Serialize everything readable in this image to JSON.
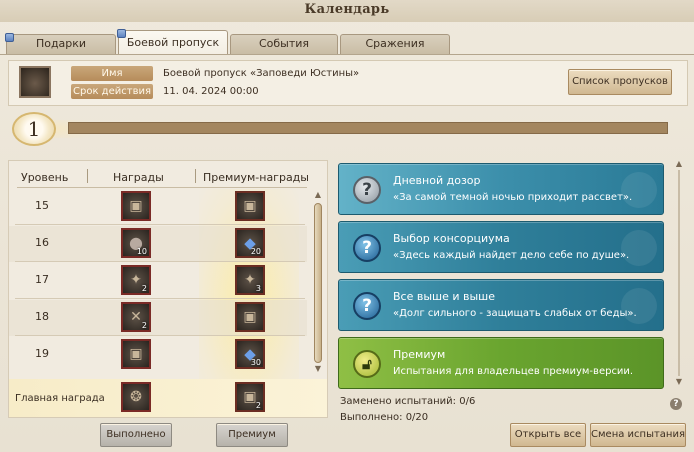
{
  "window": {
    "title": "Календарь"
  },
  "tabs": [
    {
      "label": "Подарки",
      "active": false,
      "marker": true
    },
    {
      "label": "Боевой пропуск",
      "active": true,
      "marker": true
    },
    {
      "label": "События",
      "active": false,
      "marker": false
    },
    {
      "label": "Сражения",
      "active": false,
      "marker": false
    }
  ],
  "pass_info": {
    "name_label": "Имя",
    "name_value": "Боевой пропуск «Заповеди Юстины»",
    "period_label": "Срок действия",
    "period_value": "11. 04. 2024 00:00",
    "list_button": "Список пропусков"
  },
  "level": {
    "current": "1",
    "progress": 0
  },
  "rewards": {
    "headers": {
      "level": "Уровень",
      "rewards": "Награды",
      "premium": "Премиум-награды"
    },
    "rows": [
      {
        "level": "15",
        "reward_icon": "chest-icon",
        "reward_qty": "",
        "premium_icon": "chest-icon",
        "premium_qty": ""
      },
      {
        "level": "16",
        "reward_icon": "orb-icon",
        "reward_qty": "10",
        "premium_icon": "blue-crystal-icon",
        "premium_qty": "20"
      },
      {
        "level": "17",
        "reward_icon": "dark-item-icon",
        "reward_qty": "2",
        "premium_icon": "dark-item-icon",
        "premium_qty": "3"
      },
      {
        "level": "18",
        "reward_icon": "scroll-icon",
        "reward_qty": "2",
        "premium_icon": "chest-icon",
        "premium_qty": ""
      },
      {
        "level": "19",
        "reward_icon": "chest-icon",
        "reward_qty": "",
        "premium_icon": "blue-crystal-icon",
        "premium_qty": "30"
      }
    ],
    "main_reward": {
      "label": "Главная награда",
      "reward_icon": "amulet-icon",
      "premium_icon": "chest-icon",
      "premium_qty": "2"
    }
  },
  "buttons": {
    "completed": "Выполнено",
    "premium": "Премиум",
    "open_all": "Открыть все",
    "change_trials": "Смена испытания"
  },
  "missions": [
    {
      "title": "Дневной дозор",
      "desc": "«За самой темной ночью приходит рассвет».",
      "icon": "question-icon",
      "style": "first"
    },
    {
      "title": "Выбор консорциума",
      "desc": "«Здесь каждый найдет дело себе по душе».",
      "icon": "question-icon",
      "style": "blue"
    },
    {
      "title": "Все выше и выше",
      "desc": "«Долг сильного - защищать слабых от беды».",
      "icon": "question-icon",
      "style": "blue"
    },
    {
      "title": "Премиум",
      "desc": "Испытания для владельцев премиум-версии.",
      "icon": "lock-icon",
      "style": "premium"
    }
  ],
  "stats": {
    "replaced": "Заменено испытаний: 0/6",
    "completed": "Выполнено: 0/20"
  },
  "colors": {
    "mission_blue": "#2f7f9a",
    "mission_premium": "#6aa52f",
    "accent_tan": "#b68c5b",
    "item_border": "#7a2a26"
  }
}
